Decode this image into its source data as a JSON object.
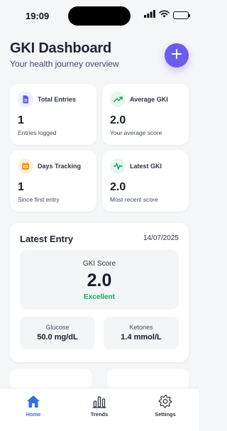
{
  "status_bar": {
    "time": "19:09"
  },
  "header": {
    "title": "GKI Dashboard",
    "subtitle": "Your health journey overview",
    "add_icon": "plus-icon"
  },
  "stats": [
    {
      "label": "Total Entries",
      "value": "1",
      "description": "Entries logged",
      "icon": "document-icon",
      "color": "#5b5bd6",
      "bg": "#eceefb"
    },
    {
      "label": "Average GKI",
      "value": "2.0",
      "description": "Your average score",
      "icon": "trending-up-icon",
      "color": "#1aa35a",
      "bg": "#e6f6ec"
    },
    {
      "label": "Days Tracking",
      "value": "1",
      "description": "Since first entry",
      "icon": "calendar-icon",
      "color": "#f29a1b",
      "bg": "#fdf1de"
    },
    {
      "label": "Latest GKI",
      "value": "2.0",
      "description": "Most recent score",
      "icon": "pulse-icon",
      "color": "#1aa35a",
      "bg": "#e6f6ec"
    }
  ],
  "latest_entry": {
    "title": "Latest Entry",
    "date": "14/07/2025",
    "score_label": "GKI Score",
    "score_value": "2.0",
    "score_status": "Excellent",
    "status_color": "#1aa35a",
    "glucose_label": "Glucose",
    "glucose_value": "50.0 mg/dL",
    "ketones_label": "Ketones",
    "ketones_value": "1.4 mmol/L"
  },
  "tabs": [
    {
      "label": "Home",
      "icon": "home-icon",
      "active": true
    },
    {
      "label": "Trends",
      "icon": "bar-chart-icon",
      "active": false
    },
    {
      "label": "Settings",
      "icon": "gear-icon",
      "active": false
    }
  ],
  "colors": {
    "accent": "#6a5de8",
    "tab_active": "#2f6fe8",
    "background": "#f5f6f8"
  }
}
